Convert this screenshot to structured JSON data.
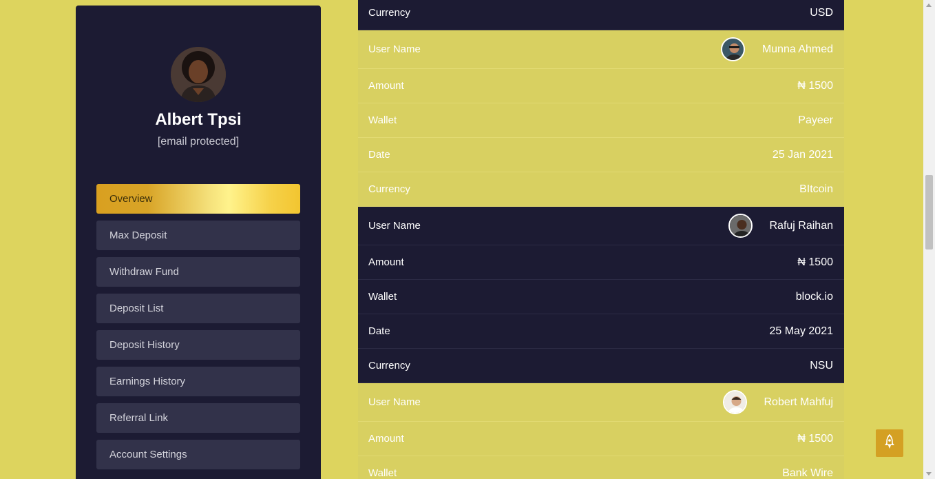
{
  "profile": {
    "name": "Albert Tpsi",
    "email": "[email protected]"
  },
  "menu": [
    {
      "label": "Overview",
      "active": true
    },
    {
      "label": "Max Deposit"
    },
    {
      "label": "Withdraw Fund"
    },
    {
      "label": "Deposit List"
    },
    {
      "label": "Deposit History"
    },
    {
      "label": "Earnings History"
    },
    {
      "label": "Referral Link"
    },
    {
      "label": "Account Settings"
    }
  ],
  "labels": {
    "user_name": "User Name",
    "amount": "Amount",
    "wallet": "Wallet",
    "date": "Date",
    "currency": "Currency"
  },
  "transactions": [
    {
      "currency": "USD"
    },
    {
      "user": "Munna Ahmed",
      "amount": "₦ 1500",
      "wallet": "Payeer",
      "date": "25 Jan 2021",
      "currency": "BItcoin"
    },
    {
      "user": "Rafuj Raihan",
      "amount": "₦ 1500",
      "wallet": "block.io",
      "date": "25 May 2021",
      "currency": "NSU"
    },
    {
      "user": "Robert Mahfuj",
      "amount": "₦ 1500",
      "wallet": "Bank Wire"
    }
  ],
  "colors": {
    "background": "#ddd45e",
    "sidebar": "#1c1b33",
    "menu_item": "#32324a",
    "accent": "#d4a023"
  },
  "icons": {
    "back_to_top": "rocket-icon"
  }
}
